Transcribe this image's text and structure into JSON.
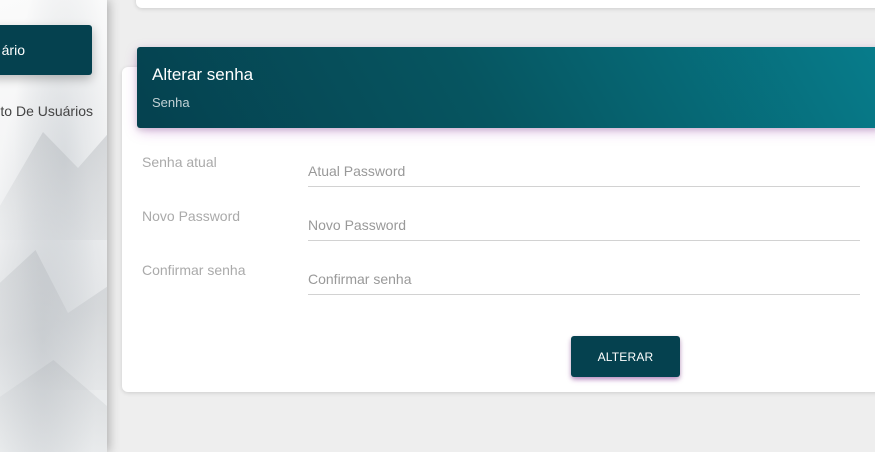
{
  "sidebar": {
    "items": [
      {
        "label": "ário",
        "active": true
      },
      {
        "label": "nto De Usuários",
        "active": false
      }
    ]
  },
  "card": {
    "title": "Alterar senha",
    "subtitle": "Senha"
  },
  "form": {
    "fields": [
      {
        "label": "Senha atual",
        "placeholder": "Atual Password",
        "value": ""
      },
      {
        "label": "Novo Password",
        "placeholder": "Novo Password",
        "value": ""
      },
      {
        "label": "Confirmar senha",
        "placeholder": "Confirmar senha",
        "value": ""
      }
    ],
    "submit_label": "ALTERAR"
  },
  "colors": {
    "primary": "#05414f",
    "header_gradient_end": "#077d8c",
    "background": "#eeeeee"
  }
}
